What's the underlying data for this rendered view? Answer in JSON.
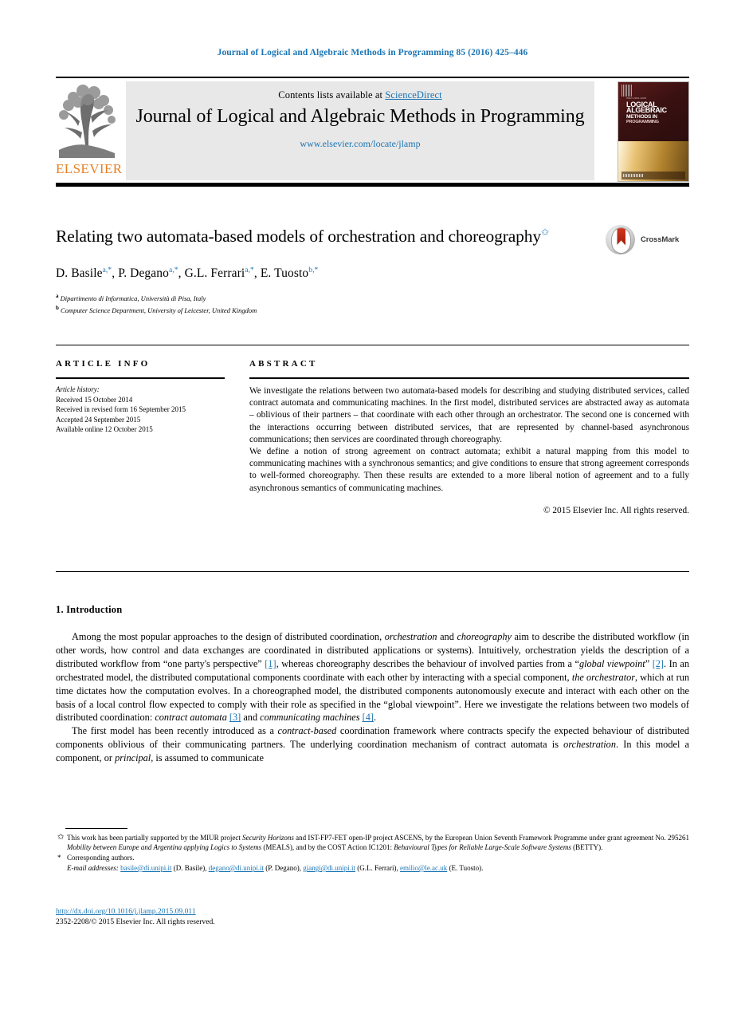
{
  "running_head": "Journal of Logical and Algebraic Methods in Programming 85 (2016) 425–446",
  "masthead": {
    "publisher": "ELSEVIER",
    "contents_prefix": "Contents lists available at ",
    "contents_link": "ScienceDirect",
    "journal_title": "Journal of Logical and Algebraic Methods in Programming",
    "journal_url": "www.elsevier.com/locate/jlamp",
    "cover": {
      "kicker": "ISSN 2352-2208",
      "line1": "LOGICAL",
      "line1_sup": "AND",
      "line2": "ALGEBRAIC",
      "line3": "METHODS IN",
      "line4": "PROGRAMMING",
      "footer": "ELSEVIER"
    }
  },
  "article": {
    "title": "Relating two automata-based models of orchestration and choreography",
    "title_footnote_mark": "✩",
    "crossmark_label": "CrossMark",
    "authors": [
      {
        "name": "D. Basile",
        "marks": "a,*"
      },
      {
        "name": "P. Degano",
        "marks": "a,*"
      },
      {
        "name": "G.L. Ferrari",
        "marks": "a,*"
      },
      {
        "name": "E. Tuosto",
        "marks": "b,*"
      }
    ],
    "affiliations": [
      {
        "mark": "a",
        "text": "Dipartimento di Informatica, Università di Pisa, Italy"
      },
      {
        "mark": "b",
        "text": "Computer Science Department, University of Leicester, United Kingdom"
      }
    ]
  },
  "info": {
    "heading": "ARTICLE INFO",
    "history_label": "Article history:",
    "history": [
      "Received 15 October 2014",
      "Received in revised form 16 September 2015",
      "Accepted 24 September 2015",
      "Available online 12 October 2015"
    ]
  },
  "abstract": {
    "heading": "ABSTRACT",
    "paragraphs": [
      "We investigate the relations between two automata-based models for describing and studying distributed services, called contract automata and communicating machines. In the first model, distributed services are abstracted away as automata – oblivious of their partners – that coordinate with each other through an orchestrator. The second one is concerned with the interactions occurring between distributed services, that are represented by channel-based asynchronous communications; then services are coordinated through choreography.",
      "We define a notion of strong agreement on contract automata; exhibit a natural mapping from this model to communicating machines with a synchronous semantics; and give conditions to ensure that strong agreement corresponds to well-formed choreography. Then these results are extended to a more liberal notion of agreement and to a fully asynchronous semantics of communicating machines."
    ],
    "copyright": "© 2015 Elsevier Inc. All rights reserved."
  },
  "body": {
    "section_number": "1.",
    "section_title": "Introduction",
    "paragraph1": {
      "t1": "Among the most popular approaches to the design of distributed coordination, ",
      "i1": "orchestration",
      "t2": " and ",
      "i2": "choreography",
      "t3": " aim to describe the distributed workflow (in other words, how control and data exchanges are coordinated in distributed applications or systems). Intuitively, orchestration yields the description of a distributed workflow from “one party's perspective” ",
      "r1": "[1]",
      "t4": ", whereas choreography describes the behaviour of involved parties from a “",
      "i3": "global viewpoint",
      "t5": "” ",
      "r2": "[2]",
      "t6": ". In an orchestrated model, the distributed computational components coordinate with each other by interacting with a special component, ",
      "i4": "the orchestrator",
      "t7": ", which at run time dictates how the computation evolves. In a choreographed model, the distributed components autonomously execute and interact with each other on the basis of a local control flow expected to comply with their role as specified in the “global viewpoint”. Here we investigate the relations between two models of distributed coordination: ",
      "i5": "contract automata",
      "t8": " ",
      "r3": "[3]",
      "t9": " and ",
      "i6": "communicating machines",
      "t10": " ",
      "r4": "[4]",
      "t11": "."
    },
    "paragraph2": {
      "t1": "The first model has been recently introduced as a ",
      "i1": "contract-based",
      "t2": " coordination framework where contracts specify the expected behaviour of distributed components oblivious of their communicating partners. The underlying coordination mechanism of contract automata is ",
      "i2": "orchestration",
      "t3": ". In this model a component, or ",
      "i3": "principal",
      "t4": ", is assumed to communicate"
    }
  },
  "footnotes": {
    "funding": {
      "mark": "✩",
      "t1": "This work has been partially supported by the MIUR project ",
      "i1": "Security Horizons",
      "t2": " and IST-FP7-FET open-IP project ASCENS, by the European Union Seventh Framework Programme under grant agreement No. 295261 ",
      "i2": "Mobility between Europe and Argentina applying Logics to Systems",
      "t3": " (MEALS), and by the COST Action IC1201: ",
      "i3": "Behavioural Types for Reliable Large-Scale Software Systems",
      "t4": " (BETTY)."
    },
    "corresponding": {
      "mark": "*",
      "text": "Corresponding authors."
    },
    "emails": {
      "label": "E-mail addresses:",
      "entries": [
        {
          "email": "basile@di.unipi.it",
          "who": "(D. Basile)",
          "sep": ", "
        },
        {
          "email": "degano@di.unipi.it",
          "who": "(P. Degano)",
          "sep": ", "
        },
        {
          "email": "giangi@di.unipi.it",
          "who": "(G.L. Ferrari)",
          "sep": ", "
        },
        {
          "email": "emilio@le.ac.uk",
          "who": "(E. Tuosto)",
          "sep": "."
        }
      ]
    }
  },
  "doi": {
    "url": "http://dx.doi.org/10.1016/j.jlamp.2015.09.011",
    "issn_line": "2352-2208/© 2015 Elsevier Inc. All rights reserved."
  },
  "colors": {
    "link": "#1b75b4",
    "elsevier_orange": "#e87f23",
    "band_gray": "#e8e8e8"
  }
}
